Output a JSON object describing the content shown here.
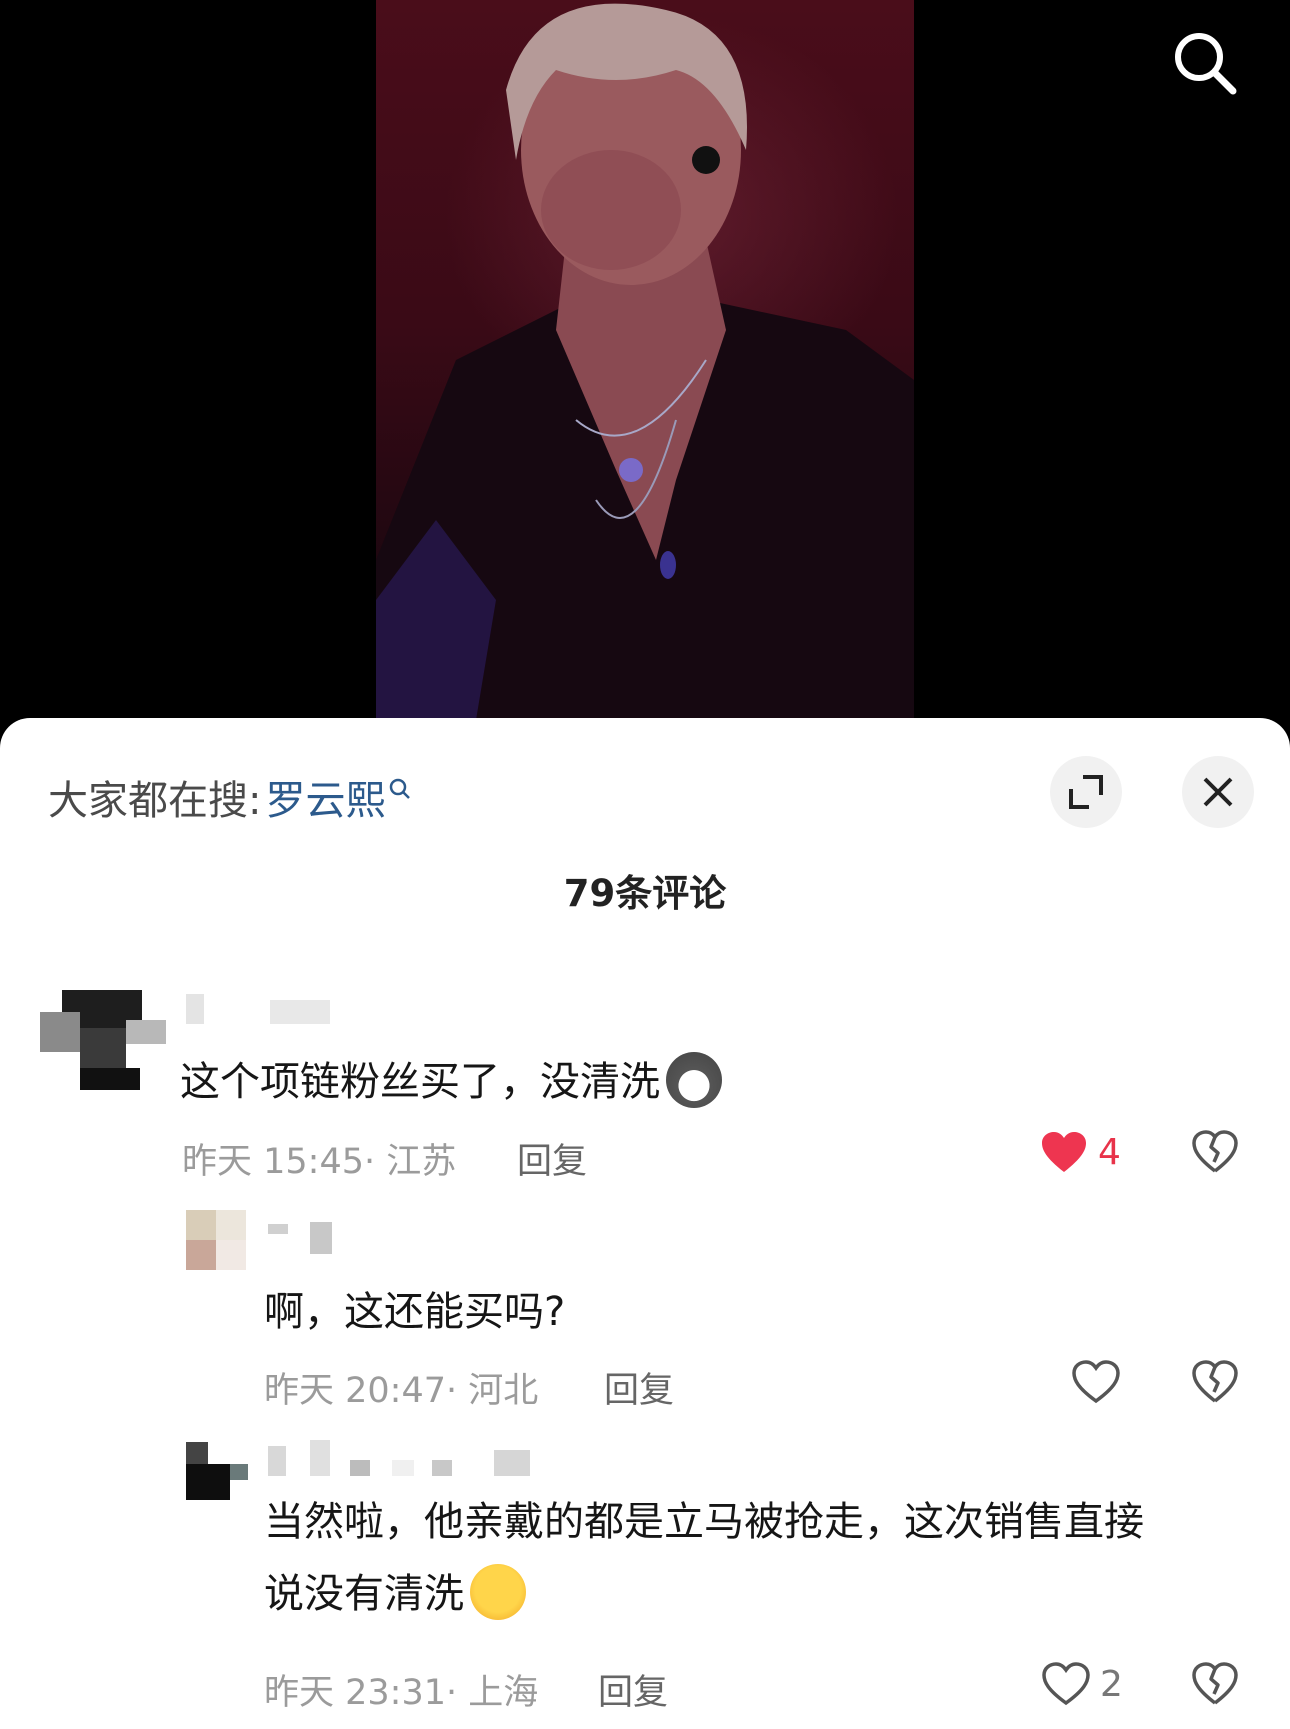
{
  "header": {
    "search_icon": "search-icon"
  },
  "sheet": {
    "trending_prefix": "大家都在搜:",
    "trending_keyword": "罗云熙",
    "comment_count_label": "79条评论",
    "expand_icon": "expand-icon",
    "close_icon": "close-icon"
  },
  "comments": [
    {
      "text": "这个项链粉丝买了，没清洗",
      "emoji": "husky-emoji",
      "time": "昨天 15:45",
      "location": "江苏",
      "reply_label": "回复",
      "likes": "4",
      "liked": true
    },
    {
      "text": "啊，这还能买吗?",
      "time": "昨天 20:47",
      "location": "河北",
      "reply_label": "回复",
      "likes": "",
      "liked": false
    },
    {
      "text_line1": "当然啦，他亲戴的都是立马被抢走，这次销售直接",
      "text_line2": "说没有清洗",
      "emoji": "shocked-face-emoji",
      "time": "昨天 23:31",
      "location": "上海",
      "reply_label": "回复",
      "likes": "2",
      "liked": false
    }
  ],
  "colors": {
    "accent_keyword": "#2c5a8c",
    "like_active": "#e8334a",
    "meta_text": "#9b9b9b"
  }
}
